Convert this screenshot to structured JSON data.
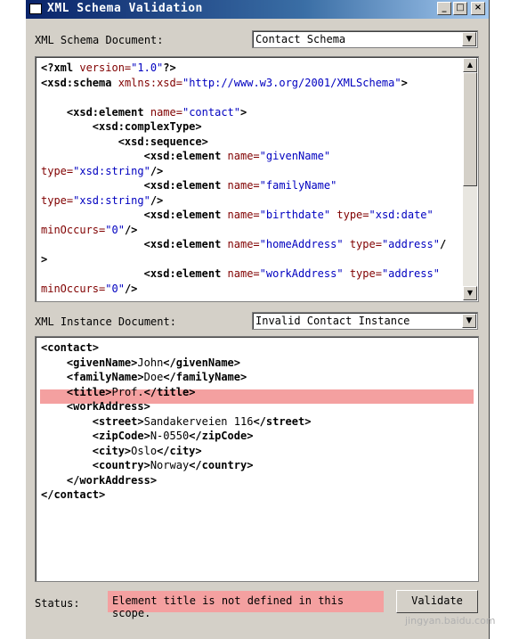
{
  "window": {
    "title": "XML Schema Validation",
    "minimize_glyph": "_",
    "maximize_glyph": "□",
    "close_glyph": "×"
  },
  "schema": {
    "label": "XML Schema Document:",
    "selected": "Contact Schema",
    "lines": [
      "<?xml version=\"1.0\"?>",
      "<xsd:schema xmlns:xsd=\"http://www.w3.org/2001/XMLSchema\">",
      "",
      "    <xsd:element name=\"contact\">",
      "        <xsd:complexType>",
      "            <xsd:sequence>",
      "                <xsd:element name=\"givenName\"",
      "type=\"xsd:string\"/>",
      "                <xsd:element name=\"familyName\"",
      "type=\"xsd:string\"/>",
      "                <xsd:element name=\"birthdate\" type=\"xsd:date\"",
      "minOccurs=\"0\"/>",
      "                <xsd:element name=\"homeAddress\" type=\"address\"/",
      ">",
      "                <xsd:element name=\"workAddress\" type=\"address\"",
      "minOccurs=\"0\"/>"
    ]
  },
  "instance": {
    "label": "XML Instance Document:",
    "selected": "Invalid Contact Instance",
    "lines": [
      "<contact>",
      "    <givenName>John</givenName>",
      "    <familyName>Doe</familyName>",
      "    <title>Prof.</title>",
      "    <workAddress>",
      "        <street>Sandakerveien 116</street>",
      "        <zipCode>N-0550</zipCode>",
      "        <city>Oslo</city>",
      "        <country>Norway</country>",
      "    </workAddress>",
      "</contact>"
    ],
    "highlighted_line": 3
  },
  "status": {
    "label": "Status:",
    "message": "Element title is not defined in this scope.",
    "validate_label": "Validate",
    "color": "#f4a0a0"
  },
  "watermark": "jingyan.baidu.com"
}
